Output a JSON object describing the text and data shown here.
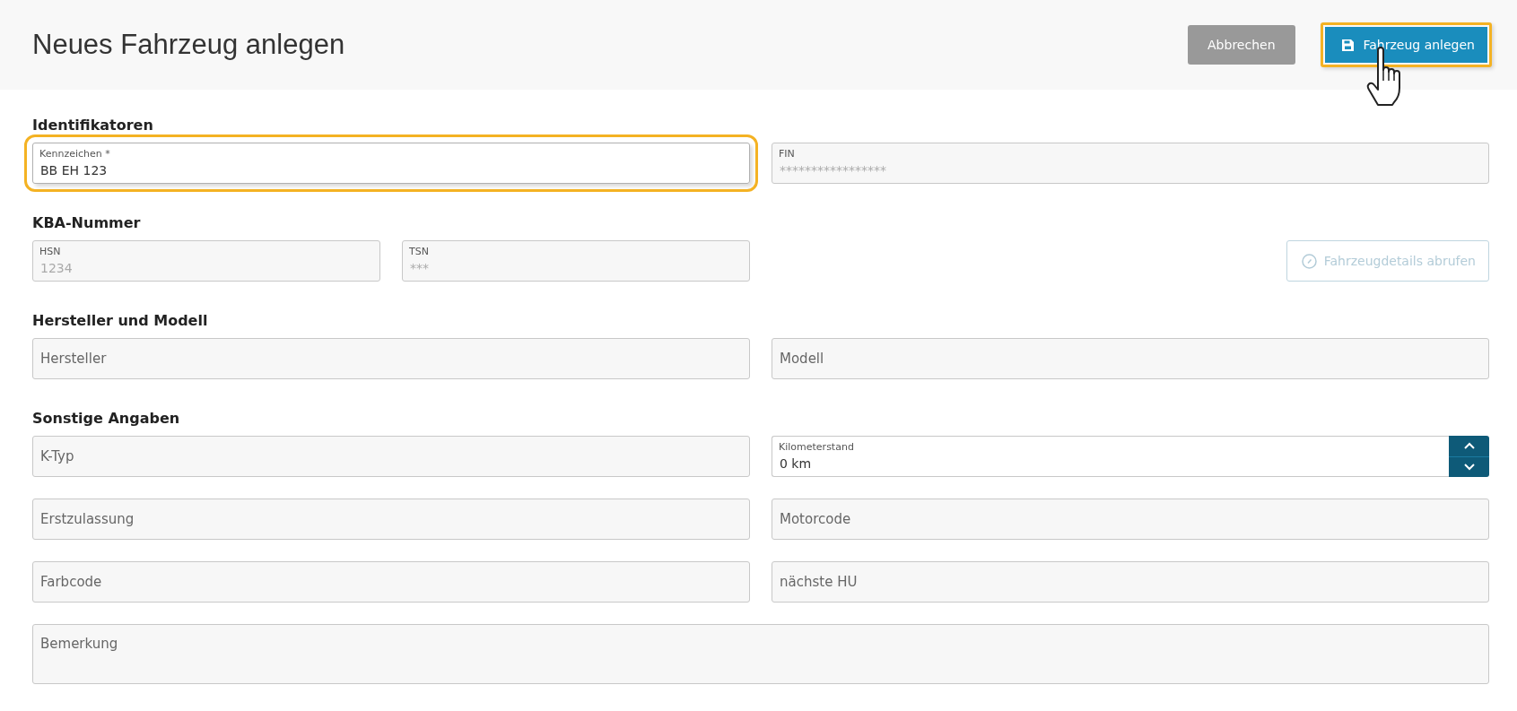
{
  "header": {
    "title": "Neues Fahrzeug anlegen",
    "buttons": [
      {
        "kind": "secondary",
        "label": "Abbrechen",
        "highlighted": false
      },
      {
        "kind": "primary",
        "label": "Fahrzeug anlegen",
        "highlighted": true
      }
    ]
  },
  "sections": [
    {
      "title": "Identifikatoren",
      "rows": [
        [
          {
            "kind": "text",
            "label": "Kennzeichen *",
            "value": "BB EH 123",
            "highlighted": true
          },
          {
            "kind": "text",
            "label": "FIN",
            "placeholder": "*****************",
            "highlighted": false
          }
        ]
      ]
    },
    {
      "title": "KBA-Nummer",
      "rows": [
        [
          {
            "kind": "short",
            "label": "HSN",
            "placeholder": "1234",
            "highlighted": false
          },
          {
            "kind": "short",
            "label": "TSN",
            "placeholder": "***",
            "highlighted": false
          },
          {
            "kind": "action",
            "label": "Fahrzeugdetails abrufen",
            "disabled": true
          }
        ]
      ]
    },
    {
      "title": "Hersteller und Modell",
      "rows": [
        [
          {
            "kind": "text",
            "placeholder": "Hersteller",
            "highlighted": false
          },
          {
            "kind": "text",
            "placeholder": "Modell",
            "highlighted": false
          }
        ]
      ]
    },
    {
      "title": "Sonstige Angaben",
      "rows": [
        [
          {
            "kind": "text",
            "placeholder": "K-Typ",
            "highlighted": false
          },
          {
            "kind": "number",
            "label": "Kilometerstand",
            "value": "0 km",
            "highlighted": false
          }
        ],
        [
          {
            "kind": "text",
            "placeholder": "Erstzulassung",
            "highlighted": false
          },
          {
            "kind": "text",
            "placeholder": "Motorcode",
            "highlighted": false
          }
        ],
        [
          {
            "kind": "text",
            "placeholder": "Farbcode",
            "highlighted": false
          },
          {
            "kind": "text",
            "placeholder": "nächste HU",
            "highlighted": false
          }
        ],
        [
          {
            "kind": "textarea",
            "placeholder": "Bemerkung",
            "highlighted": false
          }
        ]
      ]
    }
  ]
}
